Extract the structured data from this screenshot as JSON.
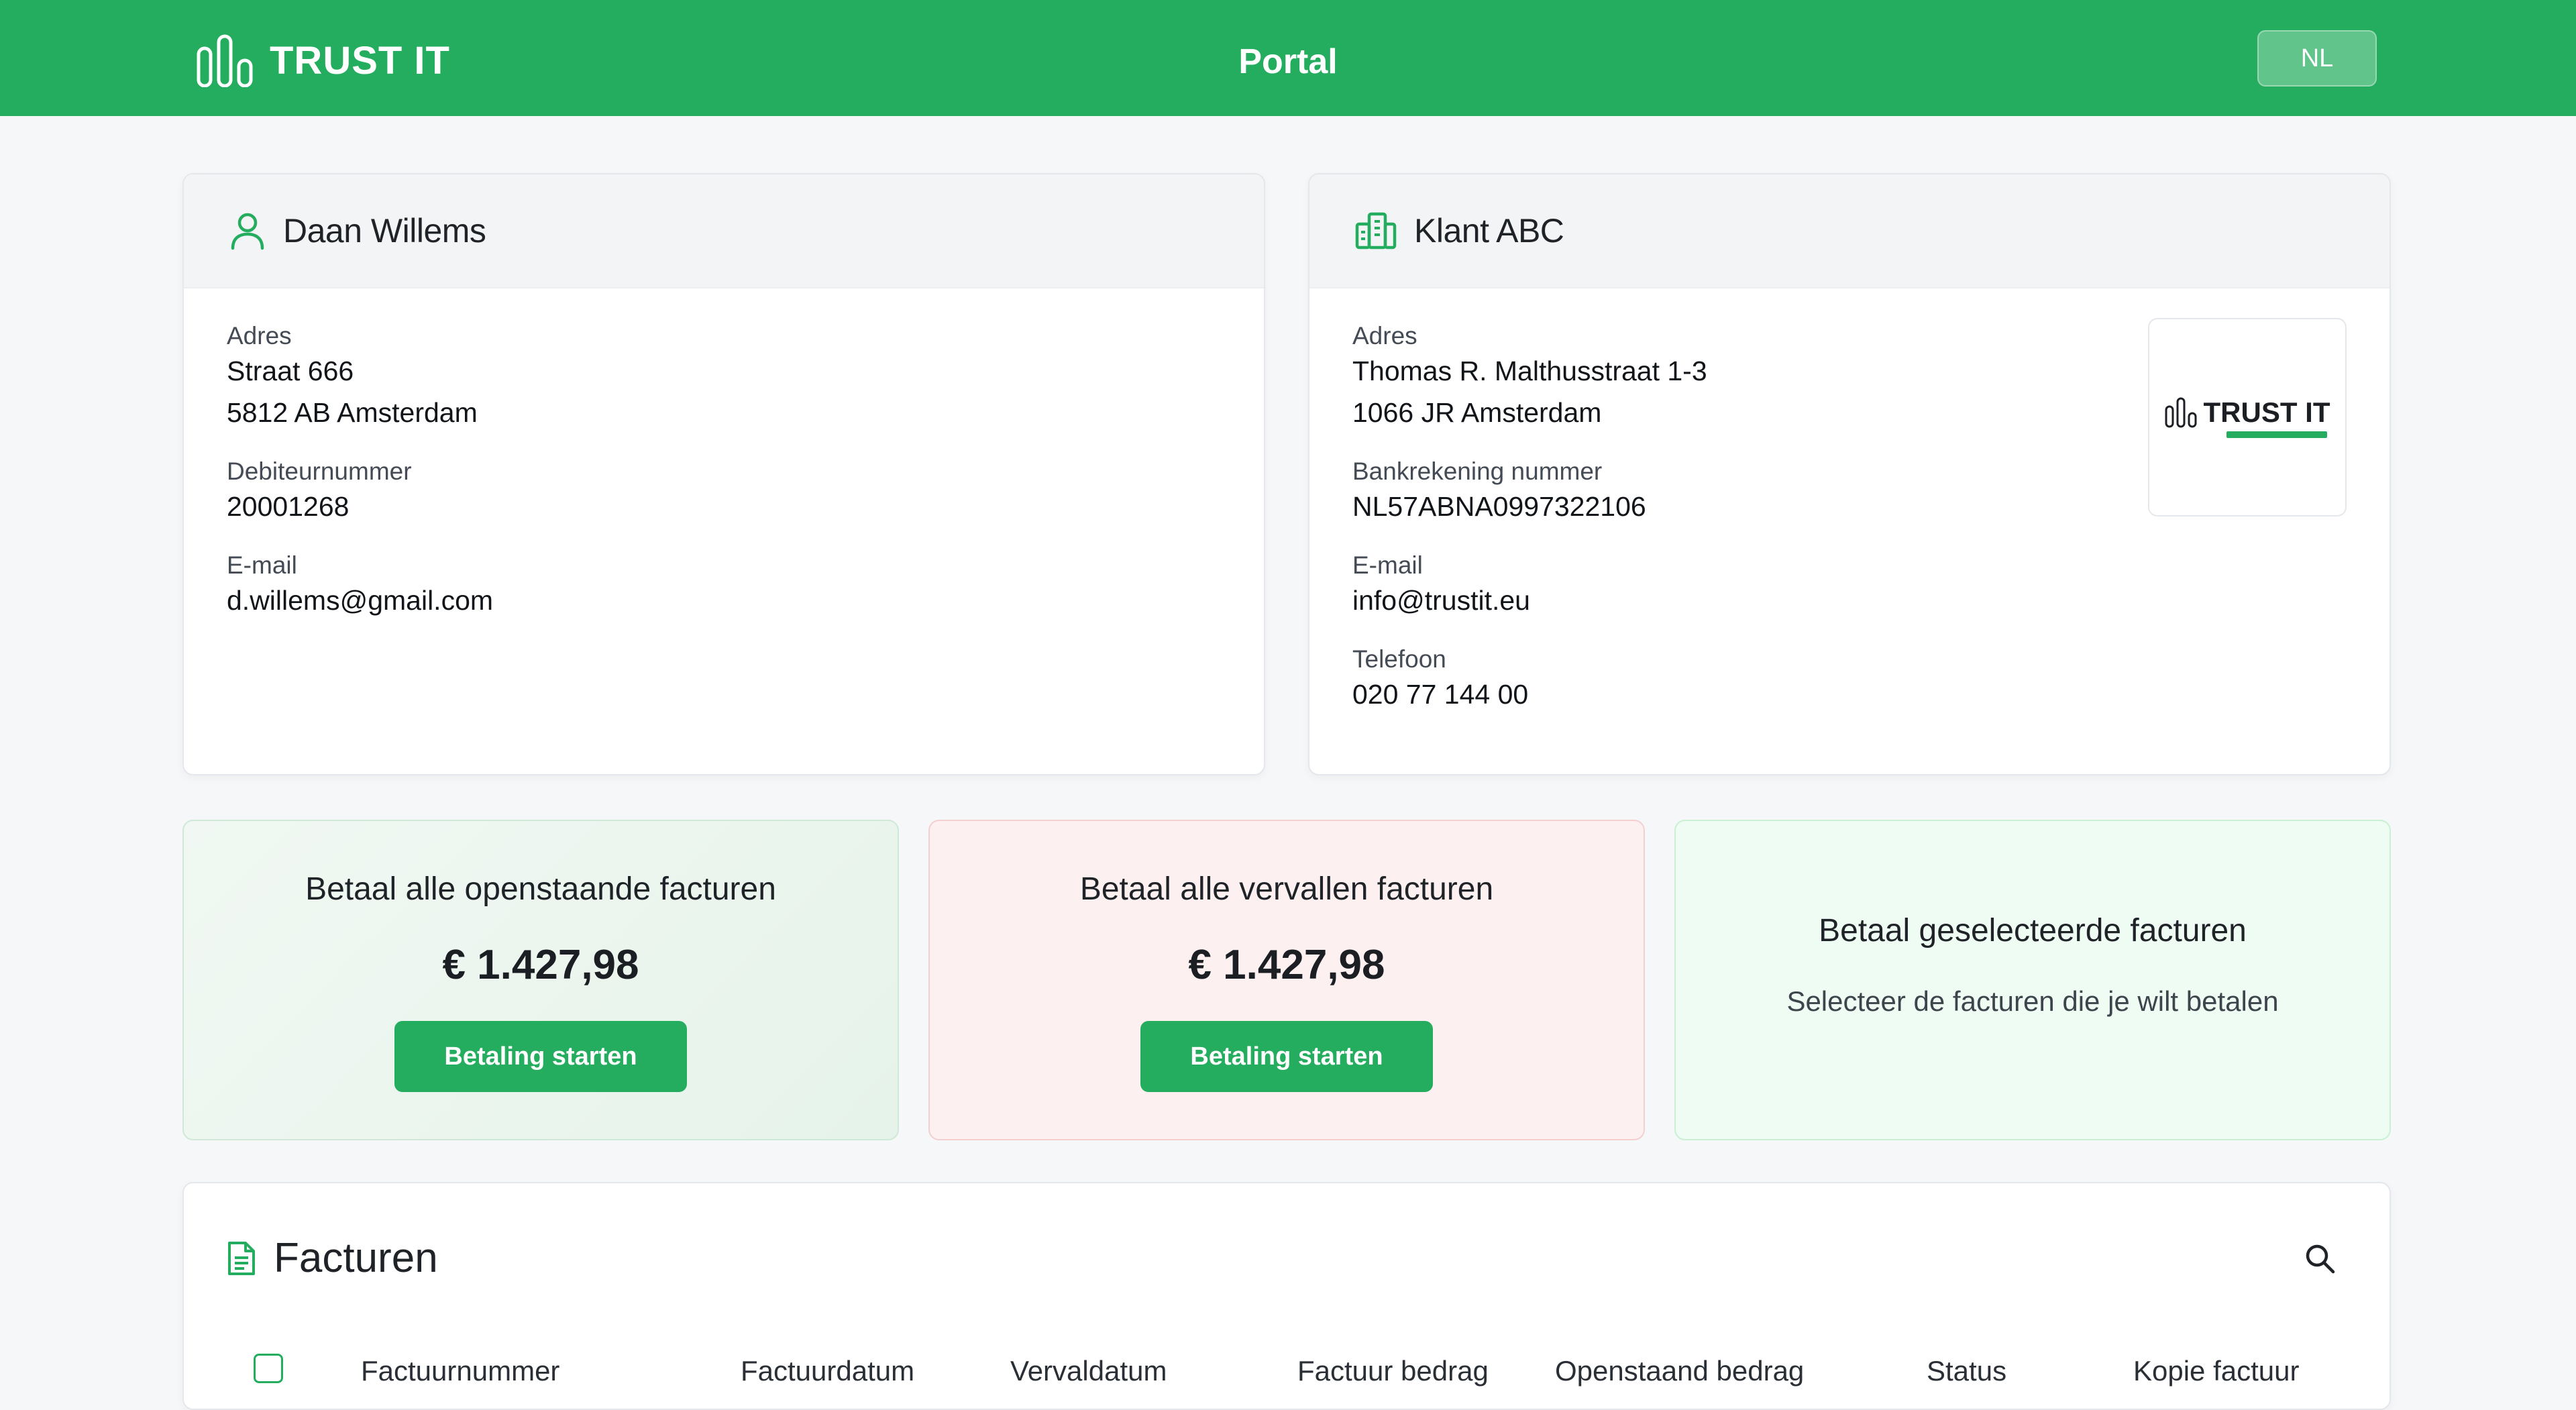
{
  "header": {
    "brand": "TRUST IT",
    "title": "Portal",
    "language": "NL"
  },
  "customer": {
    "name": "Daan Willems",
    "address_label": "Adres",
    "address_line1": "Straat 666",
    "address_line2": "5812 AB Amsterdam",
    "debtor_label": "Debiteurnummer",
    "debtor_number": "20001268",
    "email_label": "E-mail",
    "email": "d.willems@gmail.com"
  },
  "company": {
    "name": "Klant ABC",
    "address_label": "Adres",
    "address_line1": "Thomas R. Malthusstraat 1-3",
    "address_line2": "1066 JR Amsterdam",
    "bank_label": "Bankrekening nummer",
    "bank": "NL57ABNA0997322106",
    "email_label": "E-mail",
    "email": "info@trustit.eu",
    "phone_label": "Telefoon",
    "phone": "020 77 144 00",
    "logo_text": "TRUST IT"
  },
  "payments": {
    "open": {
      "title": "Betaal alle openstaande facturen",
      "amount": "€ 1.427,98",
      "button": "Betaling starten"
    },
    "overdue": {
      "title": "Betaal alle vervallen facturen",
      "amount": "€ 1.427,98",
      "button": "Betaling starten"
    },
    "selected": {
      "title": "Betaal geselecteerde facturen",
      "subtitle": "Selecteer de facturen die je wilt betalen"
    }
  },
  "invoices": {
    "title": "Facturen",
    "columns": [
      "Factuurnummer",
      "Factuurdatum",
      "Vervaldatum",
      "Factuur bedrag",
      "Openstaand bedrag",
      "Status",
      "Kopie factuur"
    ]
  },
  "colors": {
    "brand_green": "#25ad5f",
    "overdue_bg": "#fdf0f0"
  }
}
